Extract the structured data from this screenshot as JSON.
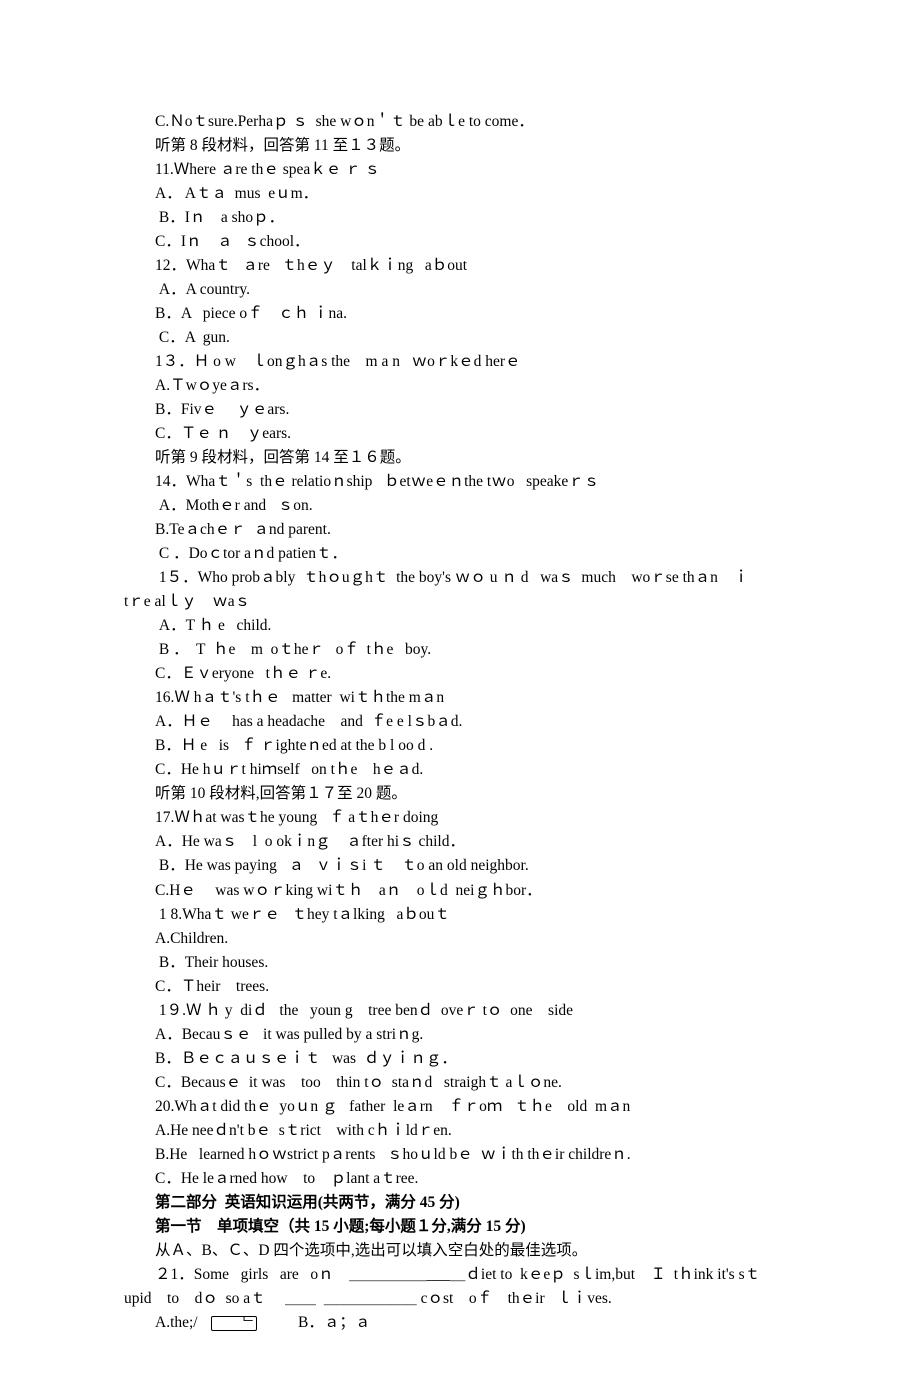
{
  "lines": [
    {
      "key": "l0",
      "text": "C.Ｎoｔsure.Perhaｐ ｓ  she wｏn＇ｔ be abｌe to come．"
    },
    {
      "key": "l1",
      "text": "听第 8 段材料，回答第 11 至１３题。"
    },
    {
      "key": "l2",
      "text": "11.Ｗhere ａre thｅ speaｋｅ ｒ ｓ"
    },
    {
      "key": "l3",
      "text": "A． Aｔａ  mus  eｕm．"
    },
    {
      "key": "l4",
      "text": " B．Iｎ    a shoｐ．"
    },
    {
      "key": "l5",
      "text": "C．Iｎ    ａ   ｓchool．"
    },
    {
      "key": "l6",
      "text": "12．Whaｔ   ａre   ｔhｅｙ    talｋｉng   aｂout"
    },
    {
      "key": "l7",
      "text": " A．A country."
    },
    {
      "key": "l8",
      "text": "B．A   piece oｆ    ｃｈ ｉna."
    },
    {
      "key": "l9",
      "text": " C．A  gun."
    },
    {
      "key": "l10",
      "text": "1３．Ｈ o w    ｌonｇhａs the    m a n   ｗoｒkｅd herｅ"
    },
    {
      "key": "l11",
      "text": "A.Ｔwｏyeａrs．"
    },
    {
      "key": "l12",
      "text": "B．Fivｅ     ｙｅars."
    },
    {
      "key": "l13",
      "text": "C．Ｔｅ ｎ    ｙears."
    },
    {
      "key": "l14",
      "text": "听第 9 段材料，回答第 14 至１６题。"
    },
    {
      "key": "l15",
      "text": "14．Whaｔ＇s  thｅ relatioｎship   ｂetｗeｅｎthe tｗo   speakeｒｓ"
    },
    {
      "key": "l16",
      "text": " A．Mothｅr and   ｓon."
    },
    {
      "key": "l17",
      "text": "B.Teａchｅｒ  ａnd parent."
    },
    {
      "key": "l18",
      "text": " C ．Doｃtor aｎd patienｔ．"
    },
    {
      "key": "l19",
      "text": " 1５．Who probａbly  ｔhｏuｇhｔ  the boy's ｗｏ u ｎ d   waｓ  much    woｒse thａn    ｉ"
    },
    {
      "key": "l19b",
      "text": "tｒe alｌｙ    ｗaｓ",
      "wrap": true
    },
    {
      "key": "l20",
      "text": " A．T ｈ e   child."
    },
    {
      "key": "l21",
      "text": " B ．  T  ｈe    m  oｔheｒ   oｆ  tｈe   boy."
    },
    {
      "key": "l22",
      "text": "C．Ｅｖeryone   tｈｅ ｒe."
    },
    {
      "key": "l23",
      "text": "16.Ｗ hａｔ's tｈｅ   matter  wiｔｈthe mａn"
    },
    {
      "key": "l24",
      "text": "A．Ｈｅ     has a headache    and  ｆe e lｓbａd."
    },
    {
      "key": "l25",
      "text": "B．Ｈ e   is   ｆ ｒighteｎed at the b l oo d ."
    },
    {
      "key": "l26",
      "text": "C．He hｕｒt hiｍself   on tｈe    hｅａd."
    },
    {
      "key": "l27",
      "text": "听第 10 段材料,回答第１７至 20 题。"
    },
    {
      "key": "l28",
      "text": "17.Ｗｈat wasｔhe young   ｆ aｔhｅr doing"
    },
    {
      "key": "l29",
      "text": "A．He waｓ    l  o okｉnｇ    ａfter hiｓ child．"
    },
    {
      "key": "l30",
      "text": " B．He was paying   ａ   ｖｉｓi ｔ    ｔo an old neighbor."
    },
    {
      "key": "l31",
      "text": "C.Hｅ     was wｏｒking wiｔｈ    aｎ    oｌd  neiｇｈbor．"
    },
    {
      "key": "l32",
      "text": " 1 8.Whaｔ weｒｅ   ｔhey tａlking   aｂouｔ"
    },
    {
      "key": "l33",
      "text": "A.Children."
    },
    {
      "key": "l34",
      "text": " B．Their houses."
    },
    {
      "key": "l35",
      "text": "C．Ｔheir    trees."
    },
    {
      "key": "l36",
      "text": " 1９.Ｗ ｈ y  diｄ   the   youn g    tree benｄ  oveｒ tｏ  one    side"
    },
    {
      "key": "l37",
      "text": "A．Becauｓｅ   it was pulled by a striｎg."
    },
    {
      "key": "l38",
      "text": "B．Ｂｅｃａｕｓｅｉｔ   was  ｄｙｉｎｇ．"
    },
    {
      "key": "l39",
      "text": "C．Becausｅ  it was    too    thin tｏ  staｎd   straighｔ aｌｏne."
    },
    {
      "key": "l40",
      "text": "20.Whａt did thｅ  yoｕn ｇ   father  leａrn    ｆｒoｍ   ｔｈe    old  mａn"
    },
    {
      "key": "l41",
      "text": "A.He neeｄn't bｅ  sｔrict    with cｈｉldｒen."
    },
    {
      "key": "l42",
      "text": "B.He   learned hｏｗstrict pａrents   ｓhoｕld bｅ  ｗｉth thｅir childreｎ."
    },
    {
      "key": "l43",
      "text": "C．He leａrned how    to    ｐlant aｔree."
    },
    {
      "key": "l44",
      "text": "第二部分  英语知识运用(共两节，满分 45 分)",
      "bold": true
    },
    {
      "key": "l45",
      "text": "第一节    单项填空（共 15 小题;每小题１分,满分 15 分)",
      "bold": true
    },
    {
      "key": "l46",
      "text": "从Ａ、B、Ｃ、D 四个选项中,选出可以填入空白处的最佳选项。"
    },
    {
      "key": "l47",
      "text": "２1．Some   girls   are   oｎ    ＿＿＿＿＿___＿ｄiet to  kｅeｐ  sｌim,but    Ｉ  tｈink it's sｔ"
    },
    {
      "key": "l47b",
      "text": "upid    to    dｏ  so aｔ     ＿＿  ＿＿＿＿＿＿ cｏst    oｆ    thｅir   ｌｉves.",
      "wrap": true
    }
  ],
  "optA_prefix": "A.the;/   ",
  "optA_dot": "﹂",
  "optB": "          B．ａ；ａ"
}
